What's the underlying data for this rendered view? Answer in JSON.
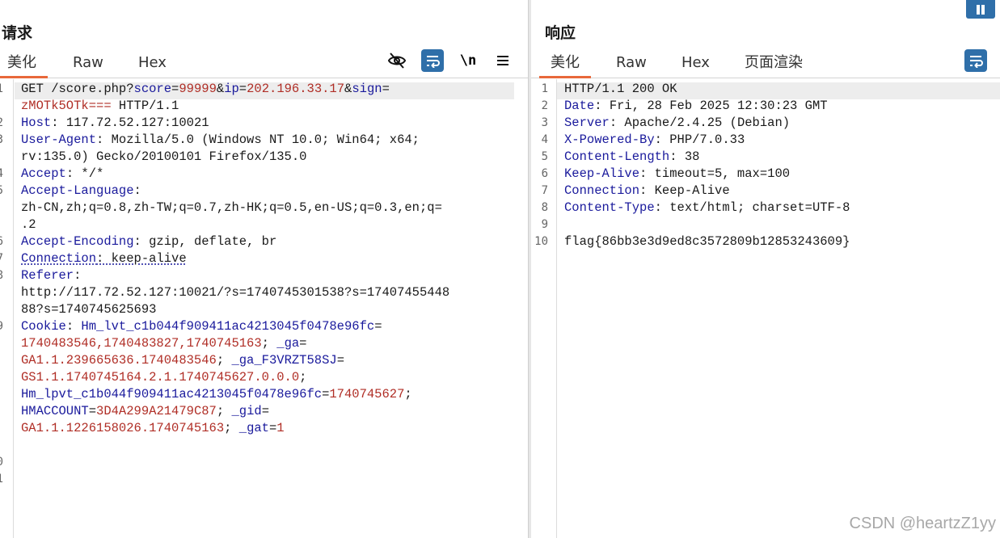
{
  "request": {
    "title": "请求",
    "tabs": [
      "美化",
      "Raw",
      "Hex"
    ],
    "active_tab": 0,
    "gutter": [
      "1",
      "",
      "2",
      "3",
      "",
      "4",
      "5",
      "",
      "",
      "6",
      "7",
      "8",
      "",
      "",
      "9",
      "",
      "",
      "",
      "",
      "",
      "",
      "",
      "0",
      "1"
    ],
    "lines": [
      [
        [
          "p",
          "GET /score.php?"
        ],
        [
          "k",
          "score"
        ],
        [
          "p",
          "="
        ],
        [
          "v",
          "99999"
        ],
        [
          "p",
          "&"
        ],
        [
          "k",
          "ip"
        ],
        [
          "p",
          "="
        ],
        [
          "v",
          "202.196.33.17"
        ],
        [
          "p",
          "&"
        ],
        [
          "k",
          "sign"
        ],
        [
          "p",
          "="
        ]
      ],
      [
        [
          "v",
          "zMOTk5OTk==="
        ],
        [
          "p",
          " HTTP/1.1"
        ]
      ],
      [
        [
          "k",
          "Host"
        ],
        [
          "p",
          ": 117.72.52.127:10021"
        ]
      ],
      [
        [
          "k",
          "User-Agent"
        ],
        [
          "p",
          ": Mozilla/5.0 (Windows NT 10.0; Win64; x64;"
        ]
      ],
      [
        [
          "p",
          "rv:135.0) Gecko/20100101 Firefox/135.0"
        ]
      ],
      [
        [
          "k",
          "Accept"
        ],
        [
          "p",
          ": */*"
        ]
      ],
      [
        [
          "k",
          "Accept-Language"
        ],
        [
          "p",
          ":"
        ]
      ],
      [
        [
          "p",
          "zh-CN,zh;q=0.8,zh-TW;q=0.7,zh-HK;q=0.5,en-US;q=0.3,en;q="
        ]
      ],
      [
        [
          "p",
          ".2"
        ]
      ],
      [
        [
          "k",
          "Accept-Encoding"
        ],
        [
          "p",
          ": gzip, deflate, br"
        ]
      ],
      [
        [
          "k",
          "Connection"
        ],
        [
          "p",
          ": keep-alive"
        ]
      ],
      [
        [
          "k",
          "Referer"
        ],
        [
          "p",
          ":"
        ]
      ],
      [
        [
          "p",
          "http://117.72.52.127:10021/?s=1740745301538?s=17407455448"
        ]
      ],
      [
        [
          "p",
          "88?s=1740745625693"
        ]
      ],
      [
        [
          "k",
          "Cookie"
        ],
        [
          "p",
          ": "
        ],
        [
          "k",
          "Hm_lvt_c1b044f909411ac4213045f0478e96fc"
        ],
        [
          "p",
          "="
        ]
      ],
      [
        [
          "v",
          "1740483546,1740483827,1740745163"
        ],
        [
          "p",
          "; "
        ],
        [
          "k",
          "_ga"
        ],
        [
          "p",
          "="
        ]
      ],
      [
        [
          "v",
          "GA1.1.239665636.1740483546"
        ],
        [
          "p",
          "; "
        ],
        [
          "k",
          "_ga_F3VRZT58SJ"
        ],
        [
          "p",
          "="
        ]
      ],
      [
        [
          "v",
          "GS1.1.1740745164.2.1.1740745627.0.0.0"
        ],
        [
          "p",
          ";"
        ]
      ],
      [
        [
          "k",
          "Hm_lpvt_c1b044f909411ac4213045f0478e96fc"
        ],
        [
          "p",
          "="
        ],
        [
          "v",
          "1740745627"
        ],
        [
          "p",
          ";"
        ]
      ],
      [
        [
          "k",
          "HMACCOUNT"
        ],
        [
          "p",
          "="
        ],
        [
          "v",
          "3D4A299A21479C87"
        ],
        [
          "p",
          "; "
        ],
        [
          "k",
          "_gid"
        ],
        [
          "p",
          "="
        ]
      ],
      [
        [
          "v",
          "GA1.1.1226158026.1740745163"
        ],
        [
          "p",
          "; "
        ],
        [
          "k",
          "_gat"
        ],
        [
          "p",
          "="
        ],
        [
          "v",
          "1"
        ]
      ]
    ]
  },
  "response": {
    "title": "响应",
    "tabs": [
      "美化",
      "Raw",
      "Hex",
      "页面渲染"
    ],
    "active_tab": 0,
    "gutter": [
      "1",
      "2",
      "3",
      "4",
      "5",
      "6",
      "7",
      "8",
      "9",
      "10"
    ],
    "lines": [
      [
        [
          "p",
          "HTTP/1.1 200 OK"
        ]
      ],
      [
        [
          "k",
          "Date"
        ],
        [
          "p",
          ": Fri, 28 Feb 2025 12:30:23 GMT"
        ]
      ],
      [
        [
          "k",
          "Server"
        ],
        [
          "p",
          ": Apache/2.4.25 (Debian)"
        ]
      ],
      [
        [
          "k",
          "X-Powered-By"
        ],
        [
          "p",
          ": PHP/7.0.33"
        ]
      ],
      [
        [
          "k",
          "Content-Length"
        ],
        [
          "p",
          ": 38"
        ]
      ],
      [
        [
          "k",
          "Keep-Alive"
        ],
        [
          "p",
          ": timeout=5, max=100"
        ]
      ],
      [
        [
          "k",
          "Connection"
        ],
        [
          "p",
          ": Keep-Alive"
        ]
      ],
      [
        [
          "k",
          "Content-Type"
        ],
        [
          "p",
          ": text/html; charset=UTF-8"
        ]
      ],
      [
        [
          "p",
          ""
        ]
      ],
      [
        [
          "p",
          "flag{86bb3e3d9ed8c3572809b12853243609}"
        ]
      ]
    ]
  },
  "toolbar": {
    "request_icons": [
      "eye-slash-icon",
      "wrap-icon",
      "newline-icon",
      "menu-icon"
    ],
    "newline_label": "\\n",
    "response_icons": [
      "wrap-icon"
    ]
  },
  "colors": {
    "accent": "#e8683a",
    "tool_blue": "#2f6fa9",
    "key": "#1a1a9c",
    "value": "#b02e26"
  },
  "watermark": "CSDN @heartzZ1yy"
}
